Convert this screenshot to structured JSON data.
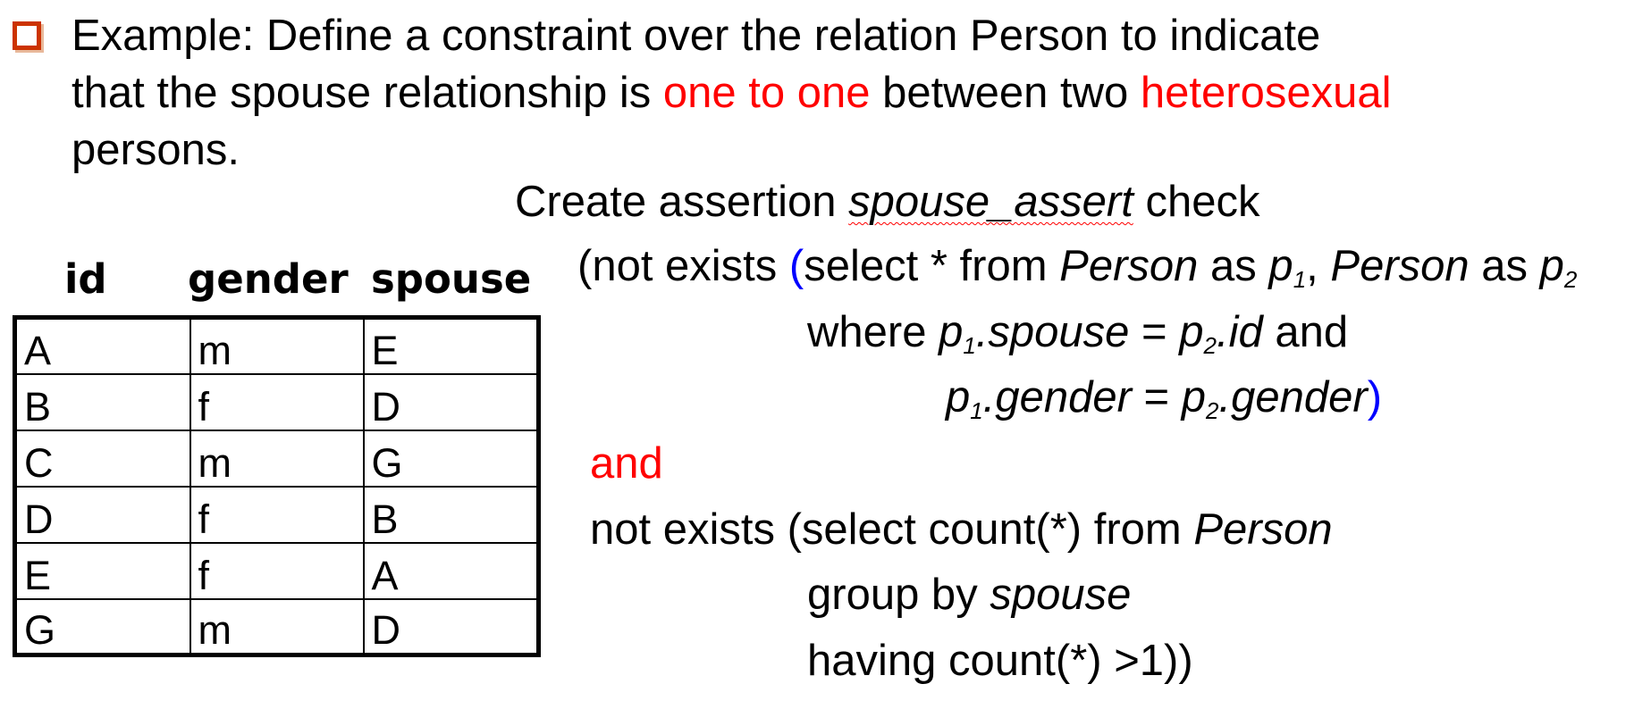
{
  "intro": {
    "line1": "Example: Define a constraint over the relation Person to indicate",
    "line2_a": "that the spouse relationship is ",
    "line2_red1": "one to one",
    "line2_b": " between two ",
    "line2_red2": "heterosexual",
    "line3": "persons."
  },
  "assertion": {
    "create": "Create assertion ",
    "name": "spouse_assert",
    "check": " check",
    "l1_a": "(not exists ",
    "l1_paren": "(",
    "l1_b": "select * from ",
    "l1_person1": "Person",
    "l1_as1": " as ",
    "l1_p": "p",
    "l1_sub1": "1",
    "l1_comma": ", ",
    "l1_person2": "Person",
    "l1_as2": " as ",
    "l1_p2": "p",
    "l1_sub2": "2",
    "l2_where": "where ",
    "l2_p1": "p",
    "l2_sub1": "1",
    "l2_spouse": ".spouse",
    "l2_eq": " = ",
    "l2_p2": "p",
    "l2_sub2": "2",
    "l2_id": ".id",
    "l2_and": " and",
    "l3_p1": "p",
    "l3_sub1": "1",
    "l3_gender1": ".gender",
    "l3_eq": " = ",
    "l3_p2": "p",
    "l3_sub2": "2",
    "l3_gender2": ".gender",
    "l3_paren": ")",
    "and": "and",
    "l5_a": "not exists (select count(*) from ",
    "l5_person": "Person",
    "l6_a": "group by ",
    "l6_spouse": "spouse",
    "l7": "having count(*) >1))"
  },
  "table": {
    "headers": [
      "id",
      "gender",
      "spouse"
    ],
    "rows": [
      [
        "A",
        "m",
        "E"
      ],
      [
        "B",
        "f",
        "D"
      ],
      [
        "C",
        "m",
        "G"
      ],
      [
        "D",
        "f",
        "B"
      ],
      [
        "E",
        "f",
        "A"
      ],
      [
        "G",
        "m",
        "D"
      ]
    ]
  },
  "colors": {
    "highlight": "#ff0000",
    "paren": "#0000ff",
    "bullet": "#cc3300"
  },
  "icons": {
    "bullet": "square-bullet-icon"
  }
}
